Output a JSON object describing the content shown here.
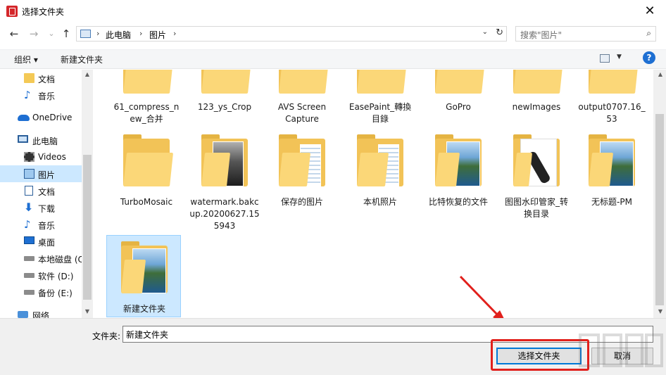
{
  "window": {
    "title": "选择文件夹",
    "close_glyph": "✕"
  },
  "nav": {
    "back_glyph": "←",
    "forward_glyph": "→",
    "recent_glyph": "⌄",
    "up_glyph": "↑",
    "breadcrumb": [
      "此电脑",
      "图片"
    ],
    "sep": "›",
    "dropdown_glyph": "⌄",
    "refresh_glyph": "↻",
    "search_placeholder": "搜索\"图片\"",
    "search_glyph": "⌕"
  },
  "toolbar": {
    "organize": "组织 ▾",
    "new_folder": "新建文件夹",
    "help": "?",
    "view_dd": "▼"
  },
  "sidebar": {
    "items": [
      {
        "label": "文档",
        "icon": "folder-icon"
      },
      {
        "label": "音乐",
        "icon": "music-icon"
      },
      {
        "label": "OneDrive",
        "icon": "onedrive-icon"
      },
      {
        "label": "此电脑",
        "icon": "this-pc-icon"
      },
      {
        "label": "Videos",
        "icon": "videos-icon"
      },
      {
        "label": "图片",
        "icon": "pictures-icon"
      },
      {
        "label": "文档",
        "icon": "documents-icon"
      },
      {
        "label": "下载",
        "icon": "download-icon"
      },
      {
        "label": "音乐",
        "icon": "music-icon"
      },
      {
        "label": "桌面",
        "icon": "desktop-icon"
      },
      {
        "label": "本地磁盘 (C",
        "icon": "drive-icon"
      },
      {
        "label": "软件 (D:)",
        "icon": "drive-icon"
      },
      {
        "label": "备份 (E:)",
        "icon": "drive-icon"
      },
      {
        "label": "网络",
        "icon": "network-icon"
      }
    ],
    "glyph_music": "♪",
    "glyph_down": "⬇",
    "scroll_up": "▲",
    "scroll_down": "▼"
  },
  "files": {
    "row1": [
      {
        "line1": "61_compress_n",
        "line2": "ew_合并"
      },
      {
        "line1": "123_ys_Crop",
        "line2": ""
      },
      {
        "line1": "AVS Screen",
        "line2": "Capture"
      },
      {
        "line1": "EasePaint_轉換",
        "line2": "目錄"
      },
      {
        "line1": "GoPro",
        "line2": ""
      },
      {
        "line1": "newImages",
        "line2": ""
      },
      {
        "line1": "output0707.16_",
        "line2": "53"
      }
    ],
    "row2": [
      {
        "line1": "TurboMosaic",
        "line2": "",
        "line3": ""
      },
      {
        "line1": "watermark.bakc",
        "line2": "up.20200627.15",
        "line3": "5943"
      },
      {
        "line1": "保存的图片",
        "line2": "",
        "line3": ""
      },
      {
        "line1": "本机照片",
        "line2": "",
        "line3": ""
      },
      {
        "line1": "比特恢复的文件",
        "line2": "",
        "line3": ""
      },
      {
        "line1": "图图水印管家_转",
        "line2": "换目录",
        "line3": ""
      },
      {
        "line1": "无标题-PM",
        "line2": "",
        "line3": ""
      }
    ],
    "row3": [
      {
        "line1": "新建文件夹"
      }
    ]
  },
  "footer": {
    "folder_label": "文件夹:",
    "folder_value": "新建文件夹",
    "select_button": "选择文件夹",
    "cancel_button": "取消"
  },
  "colors": {
    "accent": "#0078d7",
    "selection": "#cce8ff",
    "highlight_red": "#e1201c"
  }
}
